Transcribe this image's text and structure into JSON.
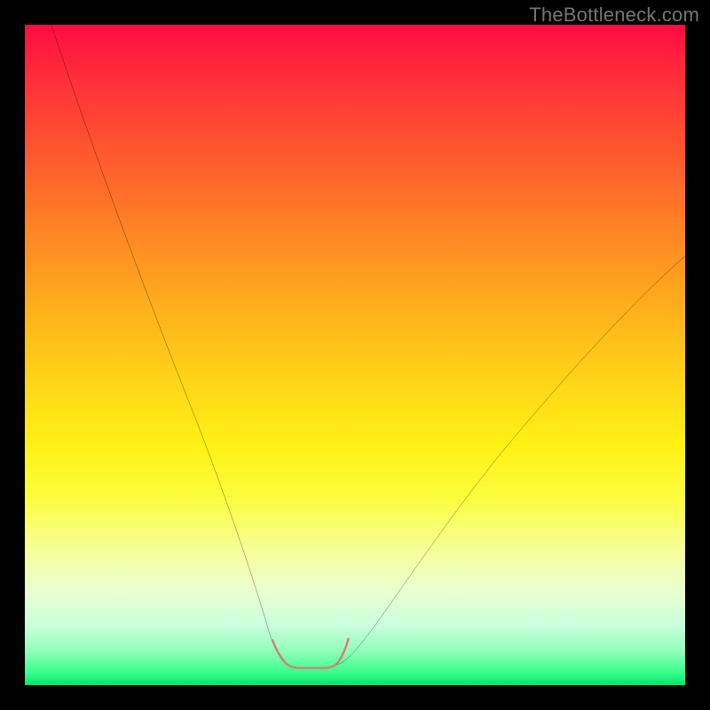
{
  "watermark": "TheBottleneck.com",
  "chart_data": {
    "type": "line",
    "title": "",
    "xlabel": "",
    "ylabel": "",
    "xlim": [
      0,
      100
    ],
    "ylim": [
      0,
      100
    ],
    "series": [
      {
        "name": "left-curve",
        "x": [
          4,
          8,
          12,
          16,
          20,
          24,
          28,
          32,
          35,
          37,
          38.5,
          40
        ],
        "values": [
          100,
          86,
          72,
          59,
          46,
          34,
          23,
          14,
          7.5,
          4,
          3,
          3
        ]
      },
      {
        "name": "right-curve",
        "x": [
          47,
          48.5,
          51,
          55,
          60,
          66,
          73,
          80,
          88,
          96,
          100
        ],
        "values": [
          3,
          3.5,
          5.5,
          9.5,
          15,
          22,
          31,
          40,
          50,
          60,
          65
        ]
      },
      {
        "name": "minimum-marker",
        "x": [
          37.5,
          38.5,
          39.5,
          41,
          43,
          45,
          46.5,
          47.5,
          48.5
        ],
        "values": [
          6.8,
          4.3,
          3.1,
          2.6,
          2.6,
          2.6,
          3.1,
          4.5,
          7.0
        ]
      }
    ],
    "annotations": []
  },
  "colors": {
    "curve_stroke": "#000000",
    "marker_stroke": "#d97a7c",
    "background_black": "#000000"
  }
}
